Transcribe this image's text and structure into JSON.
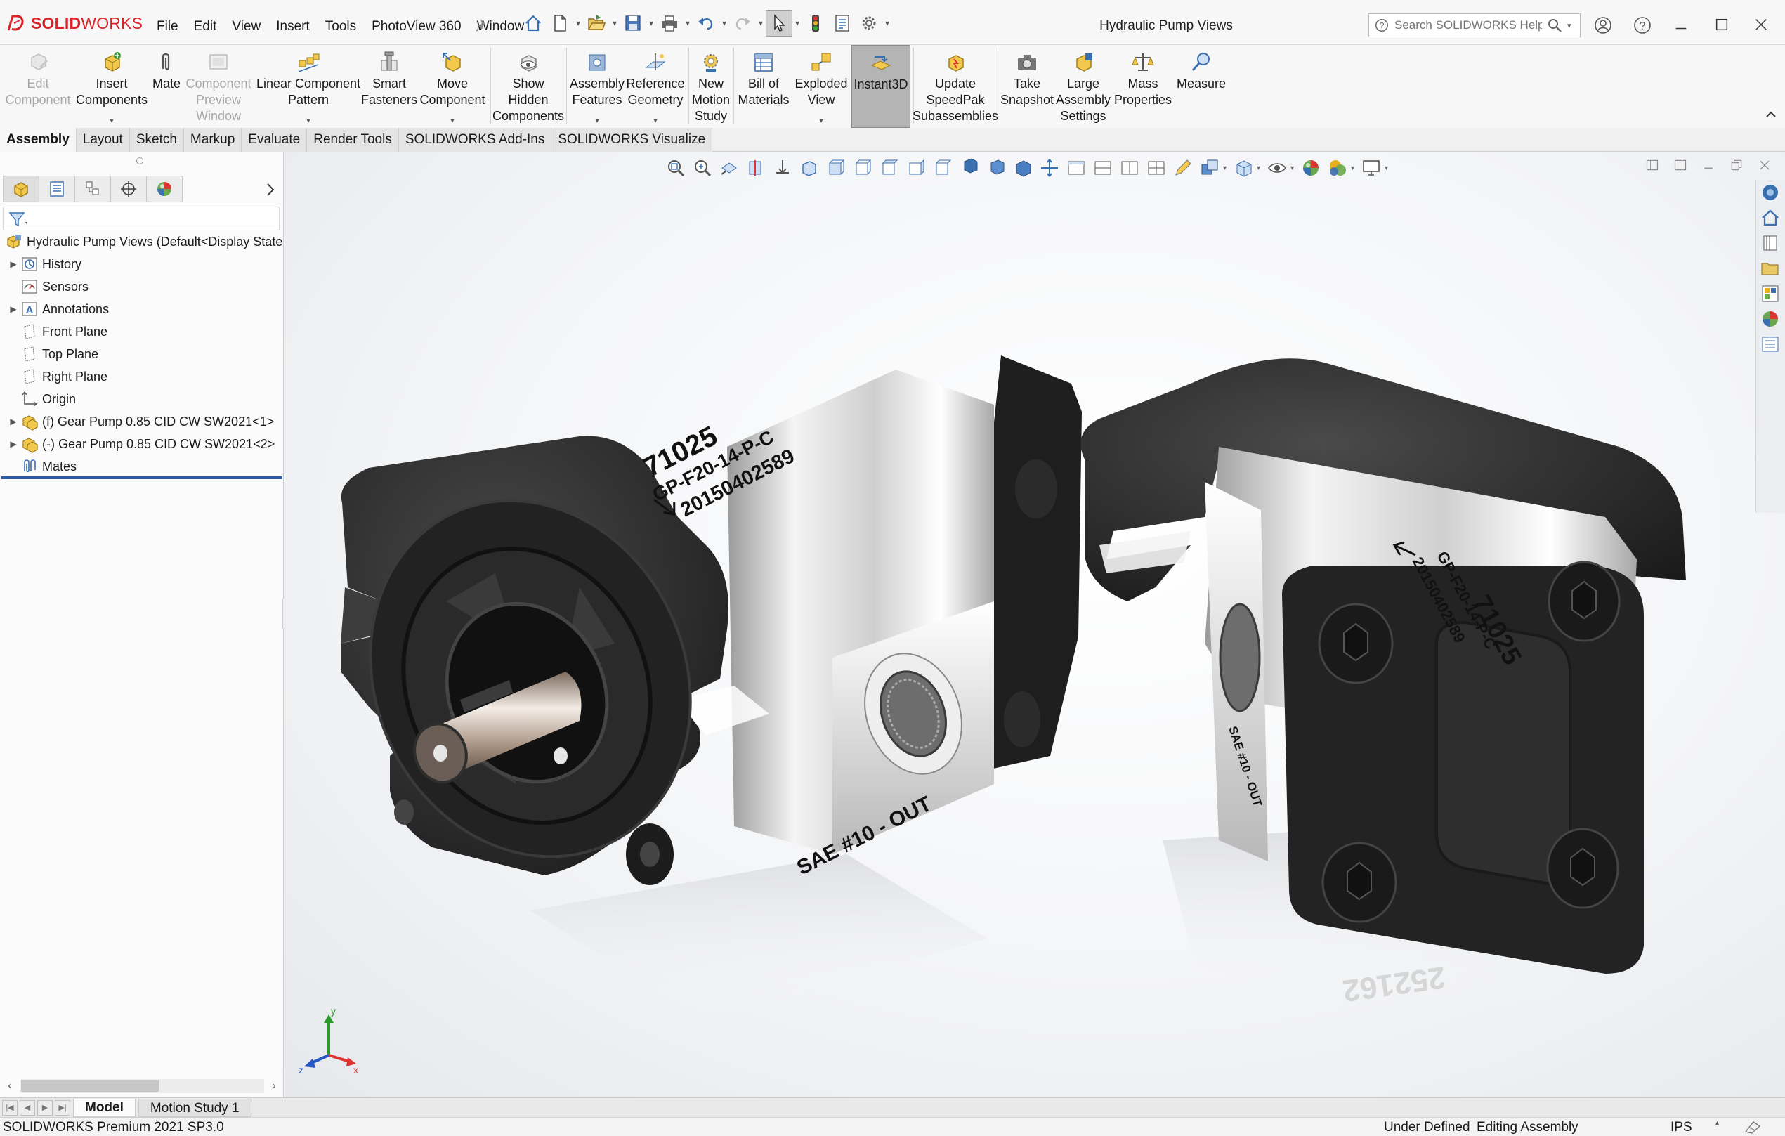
{
  "app": {
    "brand_prefix": "SOLID",
    "brand_suffix": "WORKS",
    "document_title": "Hydraulic Pump Views"
  },
  "menu": [
    "File",
    "Edit",
    "View",
    "Insert",
    "Tools",
    "PhotoView 360",
    "Window"
  ],
  "help_search": {
    "placeholder": "Search SOLIDWORKS Help"
  },
  "commands": [
    {
      "label": "Edit\nComponent",
      "icon": "edit-component-icon",
      "disabled": true
    },
    {
      "label": "Insert\nComponents",
      "icon": "insert-components-icon",
      "dropdown": true
    },
    {
      "label": "Mate",
      "icon": "mate-icon"
    },
    {
      "label": "Component\nPreview\nWindow",
      "icon": "preview-window-icon",
      "disabled": true
    },
    {
      "label": "Linear Component\nPattern",
      "icon": "linear-pattern-icon",
      "dropdown": true
    },
    {
      "label": "Smart\nFasteners",
      "icon": "smart-fasteners-icon"
    },
    {
      "label": "Move\nComponent",
      "icon": "move-component-icon",
      "dropdown": true
    },
    {
      "label": "Show\nHidden\nComponents",
      "icon": "show-hidden-icon"
    },
    {
      "label": "Assembly\nFeatures",
      "icon": "assembly-features-icon",
      "dropdown": true
    },
    {
      "label": "Reference\nGeometry",
      "icon": "reference-geometry-icon",
      "dropdown": true
    },
    {
      "label": "New\nMotion\nStudy",
      "icon": "motion-study-icon"
    },
    {
      "label": "Bill of\nMaterials",
      "icon": "bom-icon"
    },
    {
      "label": "Exploded\nView",
      "icon": "exploded-view-icon",
      "dropdown": true
    },
    {
      "label": "Instant3D",
      "icon": "instant3d-icon",
      "pressed": true
    },
    {
      "label": "Update\nSpeedPak\nSubassemblies",
      "icon": "speedpak-icon"
    },
    {
      "label": "Take\nSnapshot",
      "icon": "snapshot-icon"
    },
    {
      "label": "Large\nAssembly\nSettings",
      "icon": "large-assembly-icon"
    },
    {
      "label": "Mass\nProperties",
      "icon": "mass-properties-icon"
    },
    {
      "label": "Measure",
      "icon": "measure-icon"
    }
  ],
  "tabs": [
    "Assembly",
    "Layout",
    "Sketch",
    "Markup",
    "Evaluate",
    "Render Tools",
    "SOLIDWORKS Add-Ins",
    "SOLIDWORKS Visualize"
  ],
  "active_tab": "Assembly",
  "feature_tree": {
    "root": "Hydraulic Pump Views  (Default<Display State",
    "items": [
      {
        "label": "History",
        "icon": "history-icon",
        "expandable": true
      },
      {
        "label": "Sensors",
        "icon": "sensors-icon",
        "expandable": false
      },
      {
        "label": "Annotations",
        "icon": "annotations-icon",
        "expandable": true
      },
      {
        "label": "Front Plane",
        "icon": "plane-icon",
        "expandable": false
      },
      {
        "label": "Top Plane",
        "icon": "plane-icon",
        "expandable": false
      },
      {
        "label": "Right Plane",
        "icon": "plane-icon",
        "expandable": false
      },
      {
        "label": "Origin",
        "icon": "origin-icon",
        "expandable": false
      },
      {
        "label": "(f) Gear Pump 0.85 CID CW SW2021<1>",
        "icon": "part-icon",
        "expandable": true
      },
      {
        "label": "(-) Gear Pump 0.85 CID CW SW2021<2>",
        "icon": "part-icon",
        "expandable": true
      },
      {
        "label": "Mates",
        "icon": "mates-icon",
        "expandable": false
      }
    ]
  },
  "model_labels": {
    "pump1_number": "71025",
    "pump1_model": "GP-F20-14-P-C",
    "pump1_serial": "20150402589",
    "pump1_port": "SAE #10  -  OUT",
    "pump2_number": "71025",
    "pump2_model": "GP-F20-14-P-C",
    "pump2_serial": "20150402589",
    "pump2_port": "SAE #10  -  OUT",
    "reflection": "252162"
  },
  "triad": {
    "x": "x",
    "y": "y",
    "z": "z"
  },
  "bottom_tabs": [
    "Model",
    "Motion Study 1"
  ],
  "active_bottom_tab": "Model",
  "status": {
    "version": "SOLIDWORKS Premium 2021 SP3.0",
    "definition": "Under Defined",
    "mode": "Editing Assembly",
    "units": "IPS"
  },
  "colors": {
    "brand_red": "#d8232a",
    "pressed_button": "#b4b4b4",
    "rollback_bar": "#2a5aa8",
    "pump_body": "#2b2b2b",
    "pump_housing": "#dcdcdc"
  }
}
